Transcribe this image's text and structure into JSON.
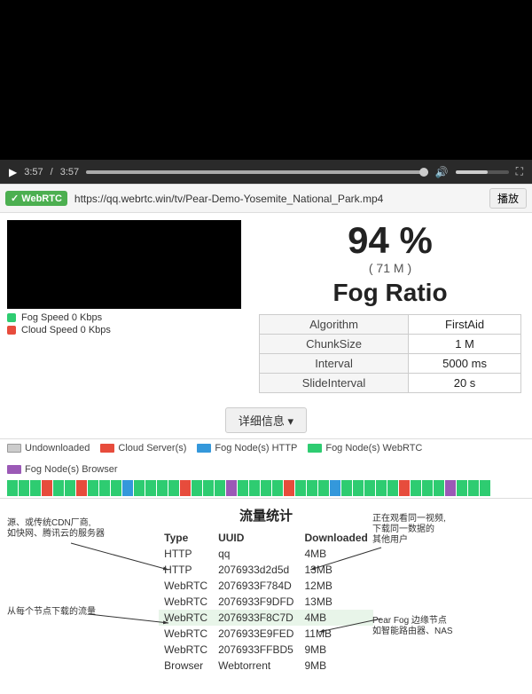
{
  "player": {
    "time_current": "3:57",
    "time_total": "3:57",
    "url": "https://qq.webrtc.win/tv/Pear-Demo-Yosemite_National_Park.mp4",
    "play_button": "播放",
    "webrtc_label": "✓ WebRTC"
  },
  "legend": {
    "fog_speed": "Fog Speed 0 Kbps",
    "cloud_speed": "Cloud Speed 0 Kbps"
  },
  "stats": {
    "percentage": "94 %",
    "size": "( 71 M )",
    "title": "Fog Ratio",
    "rows": [
      {
        "label": "Algorithm",
        "value": "FirstAid"
      },
      {
        "label": "ChunkSize",
        "value": "1 M"
      },
      {
        "label": "Interval",
        "value": "5000 ms"
      },
      {
        "label": "SlideInterval",
        "value": "20 s"
      }
    ]
  },
  "details_button": "详细信息 ▾",
  "chunk_legend": [
    {
      "type": "undownloaded",
      "label": "Undownloaded"
    },
    {
      "type": "cloud",
      "label": "Cloud Server(s)"
    },
    {
      "type": "fog-http",
      "label": "Fog Node(s) HTTP"
    },
    {
      "type": "fog-webrtc",
      "label": "Fog Node(s) WebRTC"
    },
    {
      "type": "fog-browser",
      "label": "Fog Node(s) Browser"
    }
  ],
  "traffic": {
    "title": "流量统计",
    "headers": [
      "Type",
      "UUID",
      "Downloaded"
    ],
    "rows": [
      {
        "type": "HTTP",
        "uuid": "qq",
        "downloaded": "4MB",
        "highlight": false
      },
      {
        "type": "HTTP",
        "uuid": "2076933d2d5d",
        "downloaded": "13MB",
        "highlight": false
      },
      {
        "type": "WebRTC",
        "uuid": "2076933F784D",
        "downloaded": "12MB",
        "highlight": false
      },
      {
        "type": "WebRTC",
        "uuid": "2076933F9DFD",
        "downloaded": "13MB",
        "highlight": false
      },
      {
        "type": "WebRTC",
        "uuid": "2076933F8C7D",
        "downloaded": "4MB",
        "highlight": true
      },
      {
        "type": "WebRTC",
        "uuid": "2076933E9FED",
        "downloaded": "11MB",
        "highlight": false
      },
      {
        "type": "WebRTC",
        "uuid": "2076933FFBD5",
        "downloaded": "9MB",
        "highlight": false
      },
      {
        "type": "Browser",
        "uuid": "Webtorrent",
        "downloaded": "9MB",
        "highlight": false
      }
    ]
  },
  "annotations": {
    "left1": "源、或传统CDN厂商,\n如快网、腾讯云的服务器",
    "left2": "从每个节点下载的流量",
    "right1": "正在观看同一视频,\n下载同一数据的\n其他用户",
    "right2": "Pear Fog 边缘节点\n如智能路由器、NAS"
  }
}
